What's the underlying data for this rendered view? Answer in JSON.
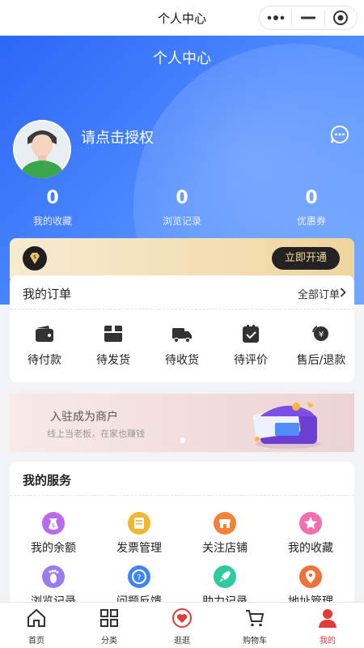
{
  "window": {
    "title": "个人中心"
  },
  "header": {
    "title": "个人中心"
  },
  "user": {
    "login_prompt": "请点击授权"
  },
  "stats": [
    {
      "value": "0",
      "label": "我的收藏"
    },
    {
      "value": "0",
      "label": "浏览记录"
    },
    {
      "value": "0",
      "label": "优惠券"
    }
  ],
  "vip": {
    "button": "立即开通"
  },
  "orders": {
    "title": "我的订单",
    "all_label": "全部订单",
    "items": [
      {
        "label": "待付款",
        "icon": "wallet-icon"
      },
      {
        "label": "待发货",
        "icon": "package-icon"
      },
      {
        "label": "待收货",
        "icon": "truck-icon"
      },
      {
        "label": "待评价",
        "icon": "review-icon"
      },
      {
        "label": "售后/退款",
        "icon": "refund-icon"
      }
    ]
  },
  "merchant_banner": {
    "title": "入驻成为商户",
    "subtitle": "线上当老板，在家也赚钱"
  },
  "services": {
    "title": "我的服务",
    "items": [
      {
        "label": "我的余额",
        "icon": "balance-icon",
        "color": "#b86bf0"
      },
      {
        "label": "发票管理",
        "icon": "invoice-icon",
        "color": "#f5b62e"
      },
      {
        "label": "关注店铺",
        "icon": "store-icon",
        "color": "#f58236"
      },
      {
        "label": "我的收藏",
        "icon": "star-icon",
        "color": "#f070b0"
      },
      {
        "label": "浏览记录",
        "icon": "footprint-icon",
        "color": "#9b7cf0"
      },
      {
        "label": "问题反馈",
        "icon": "question-icon",
        "color": "#3f86f5"
      },
      {
        "label": "助力记录",
        "icon": "rocket-icon",
        "color": "#30c9a0"
      },
      {
        "label": "地址管理",
        "icon": "location-icon",
        "color": "#f2703a"
      }
    ]
  },
  "tabbar": [
    {
      "label": "首页",
      "icon": "home-icon"
    },
    {
      "label": "分类",
      "icon": "grid-icon"
    },
    {
      "label": "逛逛",
      "icon": "heart-icon"
    },
    {
      "label": "购物车",
      "icon": "cart-icon"
    },
    {
      "label": "我的",
      "icon": "user-icon",
      "active": true
    }
  ],
  "colors": {
    "accent": "#e33b3b",
    "hero_blue": "#3a76f8",
    "vip_gold": "#f3dfb4"
  }
}
